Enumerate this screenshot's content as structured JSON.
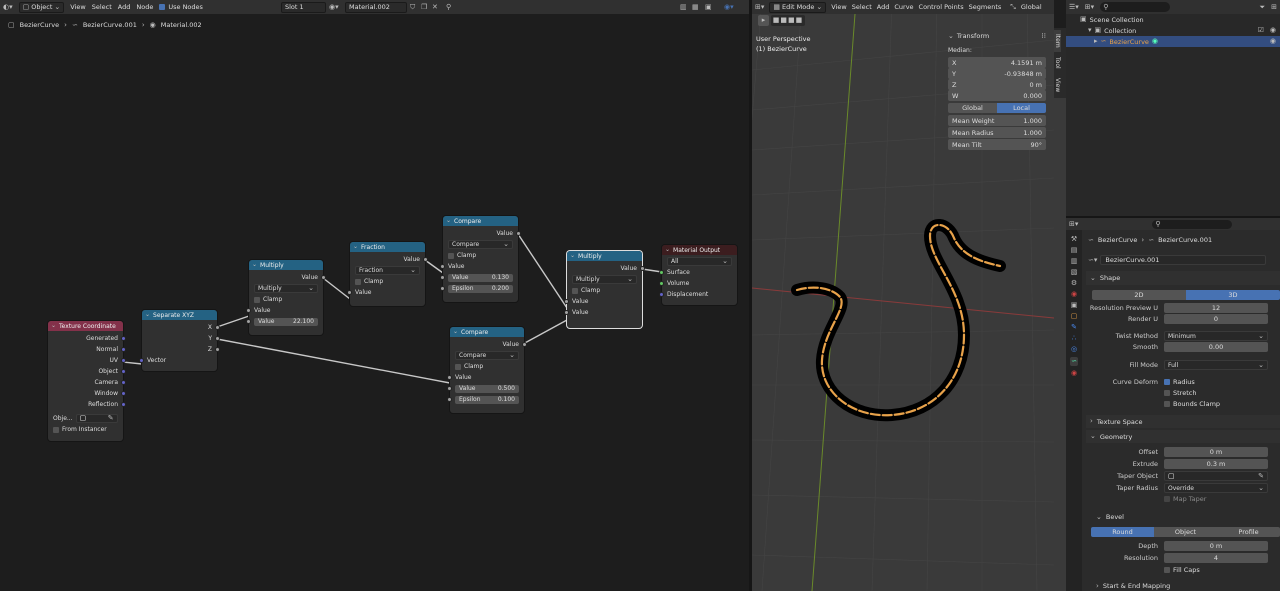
{
  "node_editor": {
    "header": {
      "mode": "Object",
      "menus": [
        "View",
        "Select",
        "Add",
        "Node"
      ],
      "use_nodes": "Use Nodes",
      "slot": "Slot 1",
      "material": "Material.002"
    },
    "breadcrumb": [
      "BezierCurve",
      "BezierCurve.001",
      "Material.002"
    ],
    "nodes": {
      "texcoord": {
        "title": "Texture Coordinate",
        "outputs": [
          "Generated",
          "Normal",
          "UV",
          "Object",
          "Camera",
          "Window",
          "Reflection"
        ],
        "object_label": "Obje...",
        "from_instancer": "From Instancer"
      },
      "separate": {
        "title": "Separate XYZ",
        "outputs": [
          "X",
          "Y",
          "Z"
        ],
        "input": "Vector"
      },
      "multiply1": {
        "title": "Multiply",
        "output": "Value",
        "op": "Multiply",
        "clamp": "Clamp",
        "in1": "Value",
        "in2_label": "Value",
        "in2_value": "22.100"
      },
      "fraction": {
        "title": "Fraction",
        "output": "Value",
        "op": "Fraction",
        "clamp": "Clamp",
        "in1": "Value"
      },
      "compare1": {
        "title": "Compare",
        "output": "Value",
        "op": "Compare",
        "clamp": "Clamp",
        "in1": "Value",
        "in2_label": "Value",
        "in2_value": "0.130",
        "eps_label": "Epsilon",
        "eps_value": "0.200"
      },
      "compare2": {
        "title": "Compare",
        "output": "Value",
        "op": "Compare",
        "clamp": "Clamp",
        "in1": "Value",
        "in2_label": "Value",
        "in2_value": "0.500",
        "eps_label": "Epsilon",
        "eps_value": "0.100"
      },
      "multiply2": {
        "title": "Multiply",
        "output": "Value",
        "op": "Multiply",
        "clamp": "Clamp",
        "in1": "Value",
        "in2": "Value"
      },
      "matout": {
        "title": "Material Output",
        "target": "All",
        "inputs": [
          "Surface",
          "Volume",
          "Displacement"
        ]
      }
    }
  },
  "viewport": {
    "header": {
      "mode": "Edit Mode",
      "menus": [
        "View",
        "Select",
        "Add",
        "Curve",
        "Control Points",
        "Segments"
      ],
      "orientation": "Global"
    },
    "overlay_title": "User Perspective",
    "overlay_object": "(1) BezierCurve",
    "tabs": [
      "Item",
      "Tool",
      "View"
    ],
    "transform": {
      "title": "Transform",
      "median": "Median:",
      "x_label": "X",
      "x": "4.1591 m",
      "y_label": "Y",
      "y": "-0.93848 m",
      "z_label": "Z",
      "z": "0 m",
      "w_label": "W",
      "w": "0.000",
      "global": "Global",
      "local": "Local",
      "mean_weight_label": "Mean Weight",
      "mean_weight": "1.000",
      "mean_radius_label": "Mean Radius",
      "mean_radius": "1.000",
      "mean_tilt_label": "Mean Tilt",
      "mean_tilt": "90°"
    }
  },
  "outliner": {
    "scene": "Scene Collection",
    "collection": "Collection",
    "object": "BezierCurve"
  },
  "properties": {
    "breadcrumb": [
      "BezierCurve",
      "BezierCurve.001"
    ],
    "datablock": "BezierCurve.001",
    "shape": {
      "title": "Shape",
      "d2": "2D",
      "d3": "3D",
      "res_preview_label": "Resolution Preview U",
      "res_preview": "12",
      "render_u_label": "Render U",
      "render_u": "0",
      "twist_label": "Twist Method",
      "twist": "Minimum",
      "smooth_label": "Smooth",
      "smooth": "0.00",
      "fill_label": "Fill Mode",
      "fill": "Full",
      "deform_label": "Curve Deform",
      "radius": "Radius",
      "stretch": "Stretch",
      "bounds_clamp": "Bounds Clamp"
    },
    "texture_space": "Texture Space",
    "geometry": {
      "title": "Geometry",
      "offset_label": "Offset",
      "offset": "0 m",
      "extrude_label": "Extrude",
      "extrude": "0.3 m",
      "taper_obj_label": "Taper Object",
      "taper_radius_label": "Taper Radius",
      "taper_radius": "Override",
      "map_taper": "Map Taper"
    },
    "bevel": {
      "title": "Bevel",
      "round": "Round",
      "object": "Object",
      "profile": "Profile",
      "depth_label": "Depth",
      "depth": "0 m",
      "resolution_label": "Resolution",
      "resolution": "4",
      "fill_caps": "Fill Caps"
    },
    "start_end": "Start & End Mapping"
  }
}
